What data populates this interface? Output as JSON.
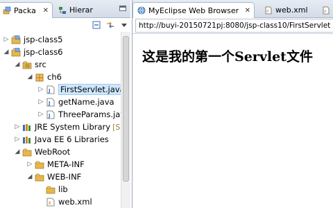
{
  "colors": {
    "accent": "#3b6bb5",
    "folder": "#e6b84a",
    "selection": "#cde8ff"
  },
  "left_tabs": {
    "active": {
      "label": "Packa",
      "icon": "package-explorer-icon",
      "close": "✕"
    },
    "inactive": {
      "label": "Hierar",
      "icon": "hierarchy-icon"
    }
  },
  "toolbar": {
    "collapse_icon": "collapse-all-icon",
    "link_icon": "link-with-editor-icon",
    "menu_icon": "view-menu-icon"
  },
  "tree": [
    {
      "label": "jsp-class5",
      "icon": "project-icon",
      "twisty": "▷",
      "name": "tree-project-jsp-class5"
    },
    {
      "label": "jsp-class6",
      "icon": "project-icon",
      "twisty": "◢",
      "name": "tree-project-jsp-class6"
    },
    {
      "label": "src",
      "icon": "source-folder-icon",
      "twisty": "◢",
      "name": "tree-src"
    },
    {
      "label": "ch6",
      "icon": "package-icon",
      "twisty": "◢",
      "name": "tree-package-ch6"
    },
    {
      "label": "FirstServlet.java",
      "icon": "java-file-icon",
      "twisty": "▷",
      "name": "tree-file-firstservlet",
      "selected": true
    },
    {
      "label": "getName.java",
      "icon": "java-file-icon",
      "twisty": "▷",
      "name": "tree-file-getname"
    },
    {
      "label": "ThreeParams.jav",
      "icon": "java-file-icon",
      "twisty": "▷",
      "name": "tree-file-threeparams"
    },
    {
      "label": "JRE System Library",
      "deco": "[Su",
      "icon": "library-icon",
      "twisty": "▷",
      "name": "tree-jre-library"
    },
    {
      "label": "Java EE 6 Libraries",
      "icon": "library-icon",
      "twisty": "▷",
      "name": "tree-javaee-libraries"
    },
    {
      "label": "WebRoot",
      "icon": "folder-icon",
      "twisty": "◢",
      "name": "tree-webroot"
    },
    {
      "label": "META-INF",
      "icon": "folder-icon",
      "twisty": "▷",
      "name": "tree-meta-inf"
    },
    {
      "label": "WEB-INF",
      "icon": "folder-icon",
      "twisty": "◢",
      "name": "tree-web-inf"
    },
    {
      "label": "lib",
      "icon": "folder-icon",
      "twisty": "",
      "name": "tree-lib"
    },
    {
      "label": "web.xml",
      "icon": "xml-file-icon",
      "twisty": "",
      "name": "tree-web-xml"
    }
  ],
  "right_tabs": {
    "active": {
      "label": "MyEclipse Web Browser",
      "icon": "globe-icon",
      "close": "✕"
    },
    "second": {
      "label": "web.xml",
      "icon": "xml-file-icon"
    },
    "third": {
      "icon": "xml-file-icon"
    }
  },
  "browser": {
    "url": "http://buyi-20150721pj:8080/jsp-class10/FirstServlet",
    "content_heading": "这是我的第一个Servlet文件"
  }
}
